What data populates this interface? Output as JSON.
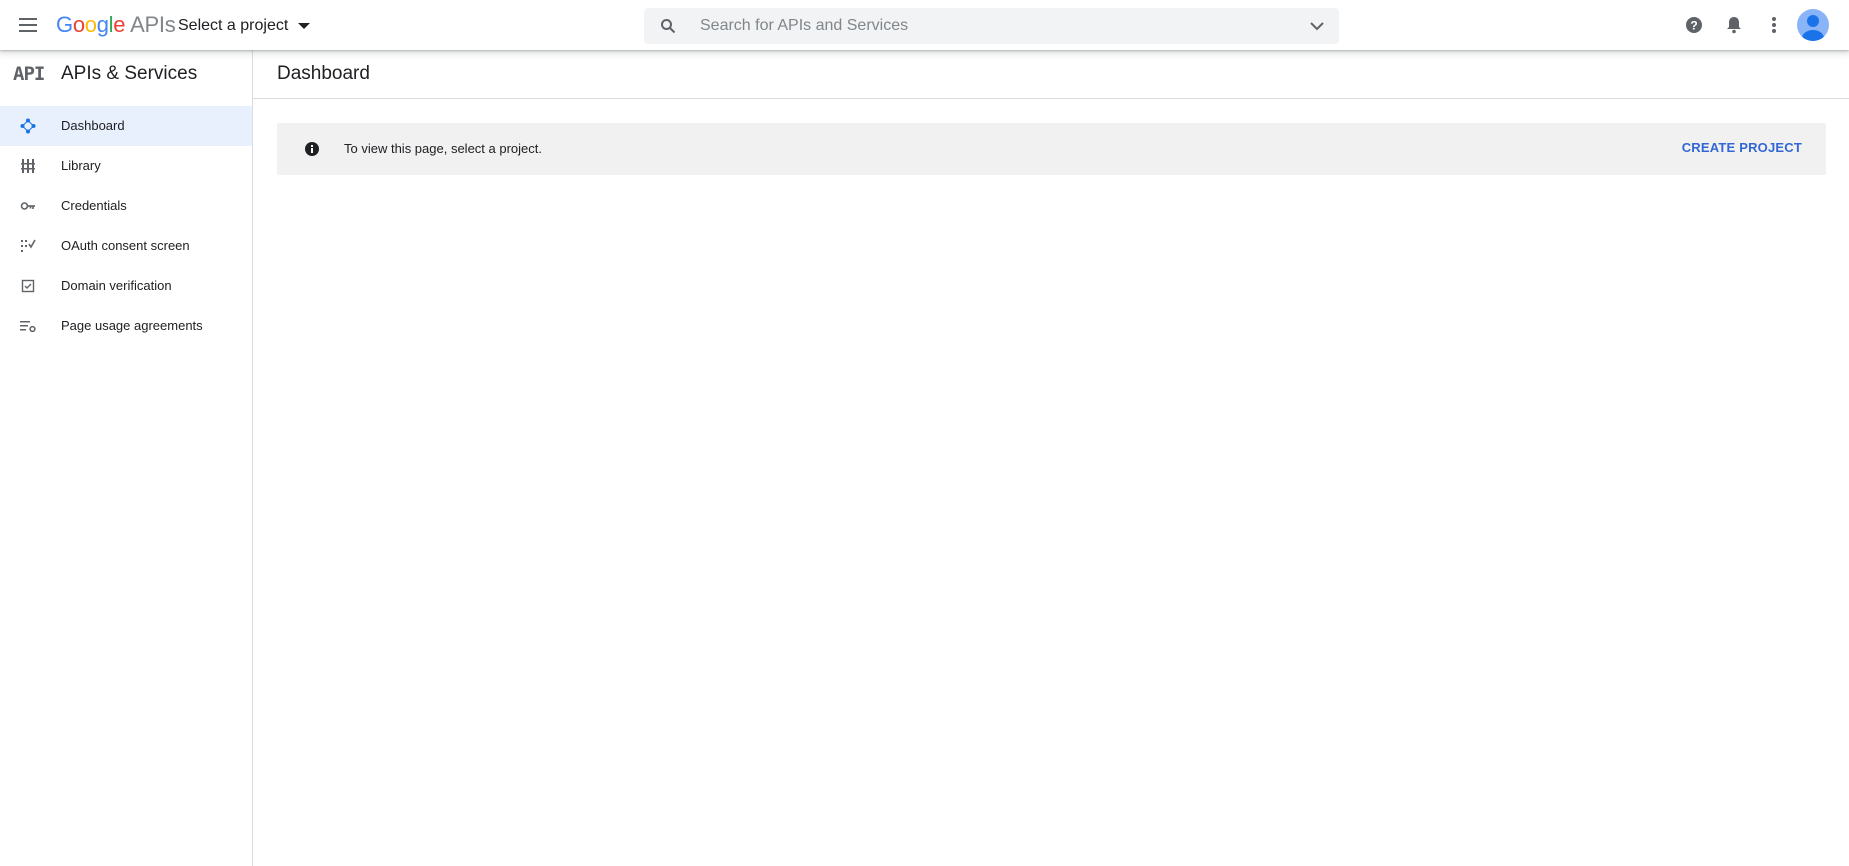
{
  "topbar": {
    "logo": {
      "google": "Google",
      "apis": "APIs"
    },
    "project_selector": "Select a project",
    "search": {
      "placeholder": "Search for APIs and Services",
      "value": ""
    },
    "icons": [
      "menu-icon",
      "search-icon",
      "chevron-down-icon",
      "help-icon",
      "notifications-icon",
      "more-vert-icon",
      "account-avatar"
    ]
  },
  "sidebar": {
    "logo_text": "API",
    "title": "APIs & Services",
    "items": [
      {
        "label": "Dashboard",
        "icon": "dashboard-icon",
        "active": true
      },
      {
        "label": "Library",
        "icon": "library-icon",
        "active": false
      },
      {
        "label": "Credentials",
        "icon": "key-icon",
        "active": false
      },
      {
        "label": "OAuth consent screen",
        "icon": "consent-icon",
        "active": false
      },
      {
        "label": "Domain verification",
        "icon": "checkbox-icon",
        "active": false
      },
      {
        "label": "Page usage agreements",
        "icon": "settings-list-icon",
        "active": false
      }
    ]
  },
  "main": {
    "title": "Dashboard",
    "banner": {
      "message": "To view this page, select a project.",
      "action": "CREATE PROJECT"
    }
  },
  "colors": {
    "accent": "#3367d6",
    "active_nav_bg": "#e8f0fe",
    "banner_bg": "#f1f1f1",
    "search_bg": "#f1f3f4"
  }
}
